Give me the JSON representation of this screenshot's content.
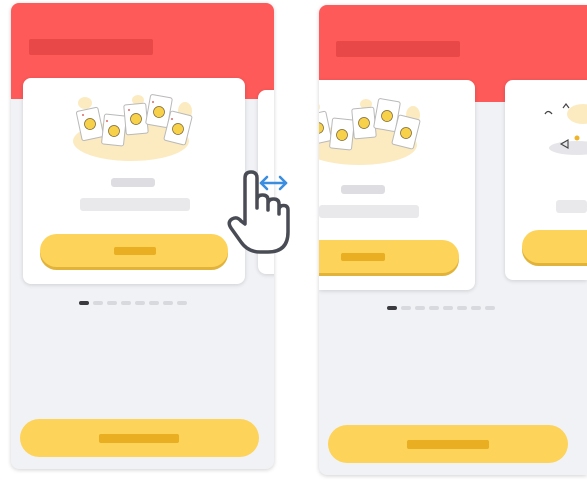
{
  "colors": {
    "header": "#fe5a5a",
    "title_placeholder": "#e94848",
    "cta": "#fdd35a",
    "cta_label_placeholder": "#e9ae22",
    "swipe_arrow": "#3b8de0",
    "active_dot": "#3a3a3f"
  },
  "carousel": {
    "slide_count": 8,
    "active_index": 0
  },
  "icons": {
    "card_illustration": "emoji-cards-illustration",
    "next_card_illustration": "doodle-illustration",
    "gesture": "swipe-hand-icon",
    "arrow": "left-right-arrow-icon"
  }
}
